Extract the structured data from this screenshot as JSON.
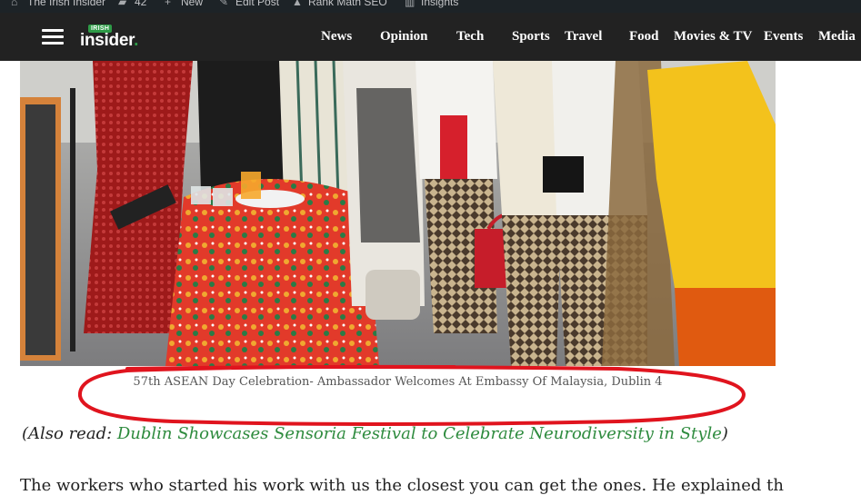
{
  "admin_bar": {
    "site_name": "The Irish Insider",
    "comments_count": "42",
    "new_label": "New",
    "edit_label": "Edit Post",
    "seo_label": "Rank Math SEO",
    "insights_label": "Insights"
  },
  "header": {
    "logo_small": "IRISH",
    "logo_word": "insider",
    "logo_dot": ".",
    "nav": [
      "News",
      "Opinion",
      "Tech",
      "Sports",
      "Travel",
      "Food",
      "Movies & TV",
      "Events",
      "Media"
    ]
  },
  "article": {
    "caption": "57th ASEAN Day Celebration- Ambassador Welcomes At Embassy Of Malaysia, Dublin 4",
    "also_read_prefix": "(Also read: ",
    "also_read_link": "Dublin Showcases Sensoria Festival to Celebrate Neurodiversity in Style",
    "also_read_suffix": ")",
    "body_partial": "The workers who started his work with us the closest you can get the ones. He explained th"
  },
  "colors": {
    "admin_bar": "#1d2327",
    "header": "#222222",
    "link_green": "#2e8b3e",
    "annotation_red": "#e0141e"
  }
}
